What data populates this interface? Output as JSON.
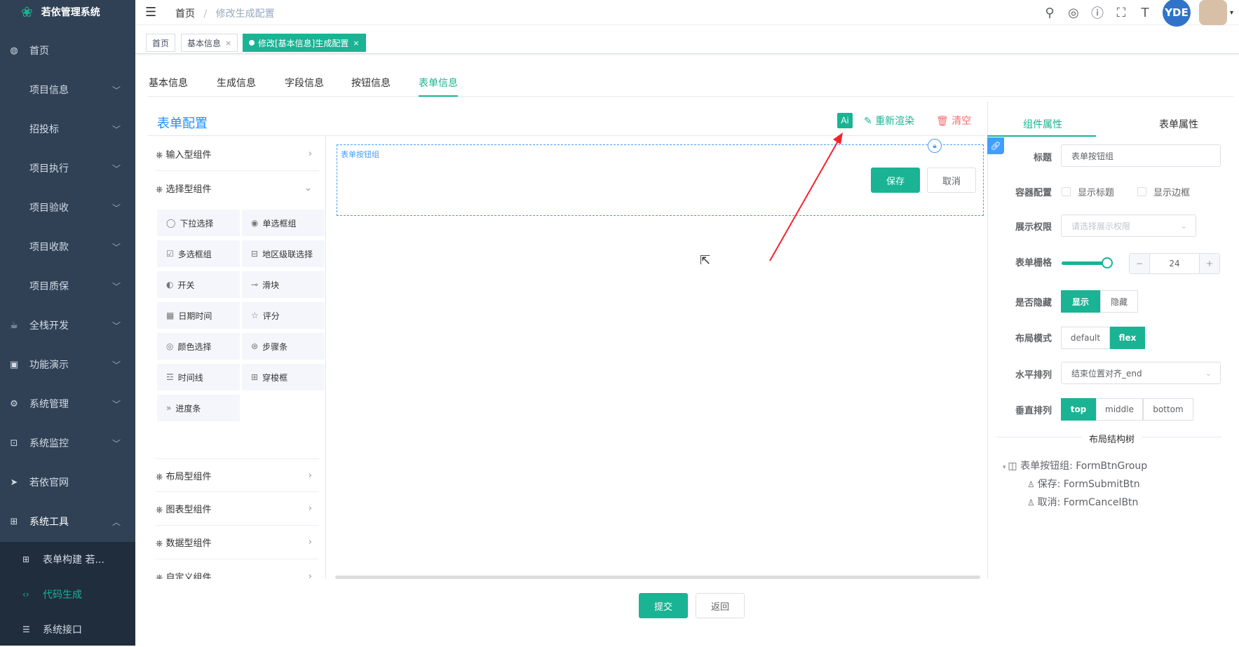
{
  "app": {
    "name": "若依管理系统"
  },
  "sidebar": {
    "items": [
      {
        "label": "首页",
        "icon": "dashboard-icon"
      },
      {
        "label": "项目信息"
      },
      {
        "label": "招投标"
      },
      {
        "label": "项目执行"
      },
      {
        "label": "项目验收"
      },
      {
        "label": "项目收款"
      },
      {
        "label": "项目质保"
      },
      {
        "label": "全栈开发",
        "icon": "code-icon"
      },
      {
        "label": "功能演示",
        "icon": "monitor-icon"
      },
      {
        "label": "系统管理",
        "icon": "gear-icon"
      },
      {
        "label": "系统监控",
        "icon": "monitor-icon"
      },
      {
        "label": "若依官网",
        "icon": "send-icon"
      },
      {
        "label": "系统工具",
        "icon": "toolbox-icon"
      }
    ],
    "sub_items": [
      {
        "label": "表单构建 若..."
      },
      {
        "label": "代码生成"
      },
      {
        "label": "系统接口"
      }
    ]
  },
  "navbar": {
    "breadcrumb_home": "首页",
    "breadcrumb_current": "修改生成配置",
    "avatar_text": "YDE"
  },
  "tags": [
    {
      "label": "首页"
    },
    {
      "label": "基本信息"
    },
    {
      "label": "修改[基本信息]生成配置"
    }
  ],
  "tabs": [
    {
      "label": "基本信息"
    },
    {
      "label": "生成信息"
    },
    {
      "label": "字段信息"
    },
    {
      "label": "按钮信息"
    },
    {
      "label": "表单信息"
    }
  ],
  "form_designer": {
    "title": "表单配置",
    "ai_label": "Ai",
    "rerender_label": "重新渲染",
    "clear_label": "清空",
    "groups": [
      {
        "label": "输入型组件"
      },
      {
        "label": "选择型组件"
      },
      {
        "label": "布局型组件"
      },
      {
        "label": "图表型组件"
      },
      {
        "label": "数据型组件"
      },
      {
        "label": "自定义组件"
      }
    ],
    "components": [
      {
        "label": "下拉选择"
      },
      {
        "label": "单选框组"
      },
      {
        "label": "多选框组"
      },
      {
        "label": "地区级联选择"
      },
      {
        "label": "开关"
      },
      {
        "label": "滑块"
      },
      {
        "label": "日期时间"
      },
      {
        "label": "评分"
      },
      {
        "label": "颜色选择"
      },
      {
        "label": "步骤条"
      },
      {
        "label": "时间线"
      },
      {
        "label": "穿梭框"
      },
      {
        "label": "进度条"
      }
    ],
    "canvas_label": "表单按钮组",
    "save_label": "保存",
    "cancel_label": "取消"
  },
  "properties": {
    "tab_component": "组件属性",
    "tab_form": "表单属性",
    "title_label": "标题",
    "title_value": "表单按钮组",
    "container_label": "容器配置",
    "show_title": "显示标题",
    "show_border": "显示边框",
    "permission_label": "展示权限",
    "permission_placeholder": "请选择展示权限",
    "grid_label": "表单栅格",
    "grid_value": "24",
    "grid_fraction": 1.0,
    "hidden_label": "是否隐藏",
    "show_option": "显示",
    "hide_option": "隐藏",
    "layout_label": "布局模式",
    "layout_default": "default",
    "layout_flex": "flex",
    "h_align_label": "水平排列",
    "h_align_value": "结束位置对齐_end",
    "v_align_label": "垂直排列",
    "v_top": "top",
    "v_middle": "middle",
    "v_bottom": "bottom",
    "tree_title": "布局结构树",
    "tree": [
      {
        "label": "表单按钮组: FormBtnGroup"
      },
      {
        "label": "保存: FormSubmitBtn"
      },
      {
        "label": "取消: FormCancelBtn"
      }
    ]
  },
  "footer": {
    "submit_label": "提交",
    "back_label": "返回"
  },
  "colors": {
    "accent": "#1ab394",
    "sidebar_bg": "#304156",
    "annotation_arrow": "#f5222d"
  }
}
